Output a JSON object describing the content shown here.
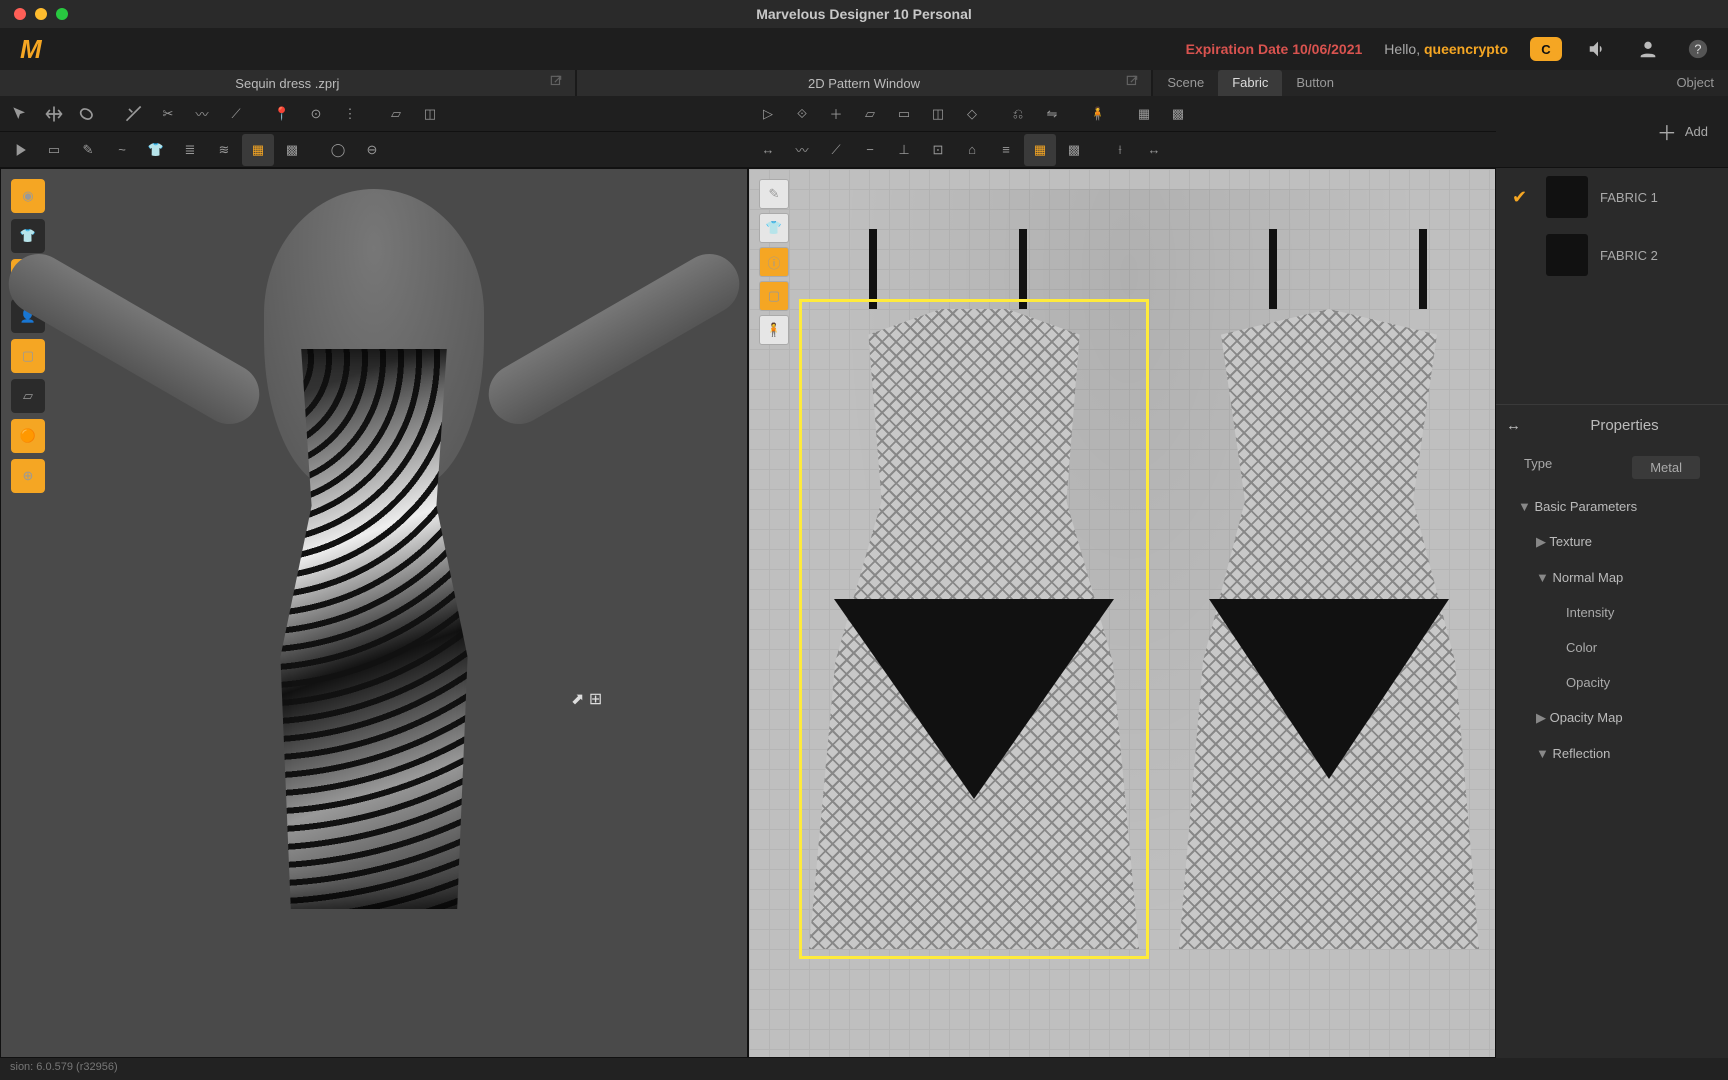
{
  "app": {
    "title": "Marvelous Designer 10 Personal"
  },
  "header": {
    "expiration_label": "Expiration Date",
    "expiration_date": "10/06/2021",
    "hello_label": "Hello,",
    "username": "queencrypto",
    "badge": "C"
  },
  "viewports": {
    "v3d_title": "Sequin dress .zprj",
    "v2d_title": "2D Pattern Window"
  },
  "tabs": {
    "scene": "Scene",
    "fabric": "Fabric",
    "button": "Button",
    "object": "Object"
  },
  "sidepanel": {
    "add_label": "Add",
    "fabrics": [
      {
        "name": "FABRIC 1",
        "selected": true
      },
      {
        "name": "FABRIC 2",
        "selected": false
      }
    ],
    "properties_header": "Properties",
    "type_label": "Type",
    "type_value": "Metal",
    "basic_params": "Basic Parameters",
    "texture": "Texture",
    "normal_map": "Normal Map",
    "intensity": "Intensity",
    "color": "Color",
    "opacity": "Opacity",
    "opacity_map": "Opacity Map",
    "reflection": "Reflection"
  },
  "status": {
    "version": "sion: 6.0.579 (r32956)"
  }
}
